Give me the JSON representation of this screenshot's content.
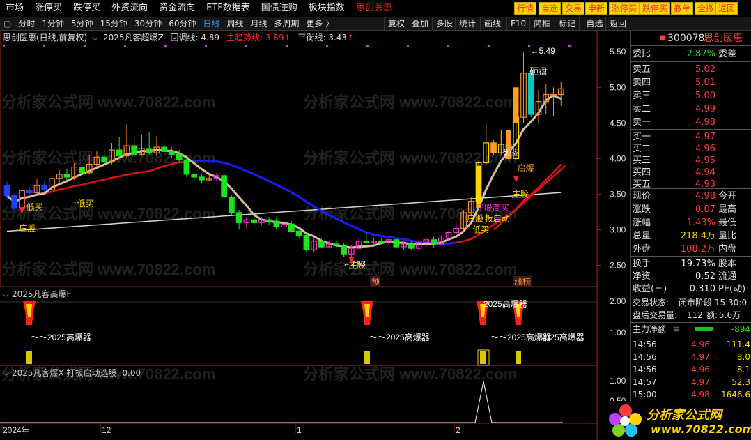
{
  "menu": {
    "items": [
      "市场",
      "涨停买",
      "跌停买",
      "外资流向",
      "资金流向",
      "ETF数据表",
      "国债逆购",
      "板块指数"
    ],
    "stock_tag": "思创医惠",
    "quick_buttons": [
      "行情",
      "自选",
      "交易",
      "申新",
      "涨停买",
      "跌停买",
      "撤单",
      "全撤",
      "返回"
    ]
  },
  "toolbar": {
    "periods": [
      "分时",
      "1分钟",
      "5分钟",
      "15分钟",
      "30分钟",
      "60分钟",
      "日线",
      "周线",
      "月线",
      "多周期",
      "更多 〉"
    ],
    "selected": "日线",
    "right_tools": [
      "复权",
      "叠加",
      "多股",
      "统计",
      "画线",
      "F10",
      "简框",
      "标记",
      "-自选",
      "返回"
    ]
  },
  "info": {
    "name": "思创医惠(日线,前复权)",
    "indicator": "2025凡客超爆Z",
    "pullback_label": "回调线:",
    "pullback_value": "4.89",
    "trend_label": "主趋势线:",
    "trend_value": "3.89",
    "balance_label": "平衡线:",
    "balance_value": "3.43"
  },
  "watermark": "分析家公式网 www.70822.com",
  "axis": {
    "main_ticks": [
      "5.50",
      "5.00",
      "4.50",
      "4.00",
      "3.50",
      "3.00",
      "2.50"
    ],
    "sub1_ticks": [
      "2.00",
      "1.00"
    ],
    "sub2_ticks": [
      "1.00",
      "0.50"
    ],
    "dates": [
      "2024年",
      "12",
      "1",
      "2"
    ]
  },
  "annotations": {
    "high_price": "5.49",
    "low_price": "2.53",
    "labels": [
      "砸盘",
      "砸盘",
      "启爆",
      "庄股",
      "庄股",
      "庄股",
      "庄股",
      "低买",
      "低买",
      "↑低买",
      "板启动",
      "预",
      "涨榜",
      "庄股高买"
    ]
  },
  "sub1": {
    "title": "2025凡客高爆F",
    "signal_label": "～～2025高爆器",
    "top_label": "2025高爆器"
  },
  "sub2": {
    "title": "2025凡客爆X",
    "value_label": "打板启动选股:",
    "value": "0.00"
  },
  "quote": {
    "code": "300078",
    "name": "思创医惠",
    "wei_bi_label": "委比",
    "wei_bi": "-2.87%",
    "wei_cha_label": "委差",
    "asks": [
      {
        "label": "卖五",
        "price": "5.02",
        "vol": ""
      },
      {
        "label": "卖四",
        "price": "5.01",
        "vol": ""
      },
      {
        "label": "卖三",
        "price": "5.00",
        "vol": ""
      },
      {
        "label": "卖二",
        "price": "4.99",
        "vol": ""
      },
      {
        "label": "卖一",
        "price": "4.98",
        "vol": ""
      }
    ],
    "bids": [
      {
        "label": "买一",
        "price": "4.97"
      },
      {
        "label": "买二",
        "price": "4.96"
      },
      {
        "label": "买三",
        "price": "4.95"
      },
      {
        "label": "买四",
        "price": "4.94"
      },
      {
        "label": "买五",
        "price": "4.93"
      }
    ],
    "stats": [
      {
        "l": "现价",
        "v": "4.98",
        "n": "今开",
        "c": "red"
      },
      {
        "l": "涨跌",
        "v": "0.07",
        "n": "最高",
        "c": "red"
      },
      {
        "l": "涨幅",
        "v": "1.43%",
        "n": "最低",
        "c": "red"
      },
      {
        "l": "总量",
        "v": "218.4万",
        "n": "量比",
        "c": "yel"
      },
      {
        "l": "外盘",
        "v": "108.2万",
        "n": "内盘",
        "c": "red"
      }
    ],
    "stats2": [
      {
        "l": "换手",
        "v": "19.73%",
        "n": "股本",
        "c": "wht"
      },
      {
        "l": "净资",
        "v": "0.52",
        "n": "流通",
        "c": "wht"
      },
      {
        "l": "收益(三)",
        "v": "-0.310",
        "n": "PE(动)",
        "c": "wht"
      }
    ],
    "status_label": "交易状态:",
    "status_value": "闭市阶段 15:30:0",
    "after_label": "盘后交易量:",
    "after_value": "112",
    "amount_label": "额:",
    "amount_value": "5.6万",
    "net_label": "主力净额",
    "net_value": "-894"
  },
  "ticks": [
    {
      "t": "14:56",
      "p": "4.96",
      "v": "111.4"
    },
    {
      "t": "14:56",
      "p": "4.97",
      "v": "8.0"
    },
    {
      "t": "14:56",
      "p": "4.96",
      "v": "8.1"
    },
    {
      "t": "14:57",
      "p": "4.97",
      "v": "52.3"
    },
    {
      "t": "15:00",
      "p": "4.98",
      "v": "1646.6"
    }
  ],
  "logo": {
    "name": "分析家公式网",
    "url": "www.70822.com"
  },
  "chart_data": {
    "type": "candlestick",
    "ylim": [
      2.3,
      5.6
    ],
    "candles": [
      [
        3.62,
        3.48,
        3.68,
        3.42
      ],
      [
        3.48,
        3.3,
        3.5,
        3.28
      ],
      [
        3.3,
        3.55,
        3.58,
        3.28
      ],
      [
        3.55,
        3.52,
        3.6,
        3.48
      ],
      [
        3.52,
        3.62,
        3.72,
        3.5
      ],
      [
        3.62,
        3.56,
        3.68,
        3.52
      ],
      [
        3.56,
        3.72,
        3.8,
        3.54
      ],
      [
        3.72,
        3.78,
        3.84,
        3.66
      ],
      [
        3.78,
        3.74,
        3.86,
        3.7
      ],
      [
        3.74,
        3.88,
        3.94,
        3.7
      ],
      [
        3.88,
        3.8,
        3.98,
        3.76
      ],
      [
        3.8,
        3.92,
        4.05,
        3.78
      ],
      [
        3.92,
        4.02,
        4.1,
        3.88
      ],
      [
        4.02,
        3.96,
        4.14,
        3.92
      ],
      [
        3.96,
        4.12,
        4.22,
        3.92
      ],
      [
        4.12,
        4.04,
        4.3,
        4.0
      ],
      [
        4.04,
        4.18,
        4.48,
        4.0
      ],
      [
        4.18,
        4.06,
        4.32,
        4.02
      ],
      [
        4.06,
        4.14,
        4.34,
        4.04
      ],
      [
        4.14,
        4.08,
        4.38,
        4.04
      ],
      [
        4.08,
        4.16,
        4.3,
        4.04
      ],
      [
        4.16,
        4.1,
        4.24,
        4.06
      ],
      [
        4.1,
        4.06,
        4.16,
        4.0
      ],
      [
        4.06,
        3.98,
        4.12,
        3.94
      ],
      [
        3.98,
        3.78,
        4.0,
        3.74
      ],
      [
        3.78,
        3.74,
        3.82,
        3.66
      ],
      [
        3.74,
        3.7,
        3.78,
        3.66
      ],
      [
        3.7,
        3.72,
        3.78,
        3.68
      ],
      [
        3.72,
        3.76,
        3.8,
        3.68
      ],
      [
        3.76,
        3.46,
        3.78,
        3.44
      ],
      [
        3.46,
        3.24,
        3.48,
        3.2
      ],
      [
        3.24,
        3.1,
        3.28,
        3.0
      ],
      [
        3.1,
        3.14,
        3.18,
        3.02
      ],
      [
        3.14,
        3.1,
        3.18,
        3.02
      ],
      [
        3.1,
        3.14,
        3.18,
        3.06
      ],
      [
        3.14,
        3.12,
        3.18,
        3.06
      ],
      [
        3.12,
        3.04,
        3.18,
        3.0
      ],
      [
        3.04,
        3.08,
        3.12,
        3.0
      ],
      [
        3.08,
        2.98,
        3.12,
        2.96
      ],
      [
        2.98,
        2.92,
        3.02,
        2.88
      ],
      [
        2.92,
        2.72,
        2.96,
        2.68
      ],
      [
        2.72,
        2.84,
        2.88,
        2.68
      ],
      [
        2.84,
        2.76,
        2.88,
        2.74
      ],
      [
        2.76,
        2.8,
        2.84,
        2.74
      ],
      [
        2.8,
        2.78,
        2.84,
        2.74
      ],
      [
        2.78,
        2.66,
        2.82,
        2.62
      ],
      [
        2.66,
        2.74,
        2.78,
        2.53
      ],
      [
        2.74,
        2.84,
        2.88,
        2.72
      ],
      [
        2.84,
        2.82,
        2.98,
        2.8
      ],
      [
        2.82,
        2.84,
        2.88,
        2.8
      ],
      [
        2.84,
        2.82,
        2.88,
        2.8
      ],
      [
        2.82,
        2.86,
        2.88,
        2.8
      ],
      [
        2.86,
        2.76,
        2.88,
        2.74
      ],
      [
        2.76,
        2.8,
        2.84,
        2.72
      ],
      [
        2.8,
        2.74,
        2.84,
        2.72
      ],
      [
        2.74,
        2.82,
        2.86,
        2.72
      ],
      [
        2.82,
        2.86,
        2.9,
        2.76
      ],
      [
        2.86,
        2.8,
        2.9,
        2.74
      ],
      [
        2.8,
        2.88,
        2.92,
        2.78
      ],
      [
        2.88,
        2.96,
        2.98,
        2.84
      ],
      [
        2.96,
        3.02,
        3.1,
        2.94
      ],
      [
        3.02,
        3.24,
        3.28,
        2.98
      ],
      [
        3.24,
        3.4,
        3.46,
        3.2
      ],
      [
        3.4,
        3.94,
        3.98,
        3.38
      ],
      [
        3.94,
        4.22,
        4.5,
        3.9
      ],
      [
        4.22,
        4.08,
        4.26,
        4.04
      ],
      [
        4.08,
        4.2,
        4.4,
        4.04
      ],
      [
        4.2,
        4.0,
        4.22,
        3.96
      ],
      [
        4.0,
        4.58,
        4.72,
        3.98
      ],
      [
        4.58,
        5.2,
        5.49,
        4.5
      ],
      [
        5.2,
        4.62,
        5.12,
        4.58
      ],
      [
        4.62,
        4.8,
        4.96,
        4.5
      ],
      [
        4.8,
        4.9,
        5.05,
        4.62
      ],
      [
        4.9,
        4.9,
        5.0,
        4.6
      ],
      [
        4.9,
        4.98,
        5.08,
        4.74
      ]
    ]
  }
}
